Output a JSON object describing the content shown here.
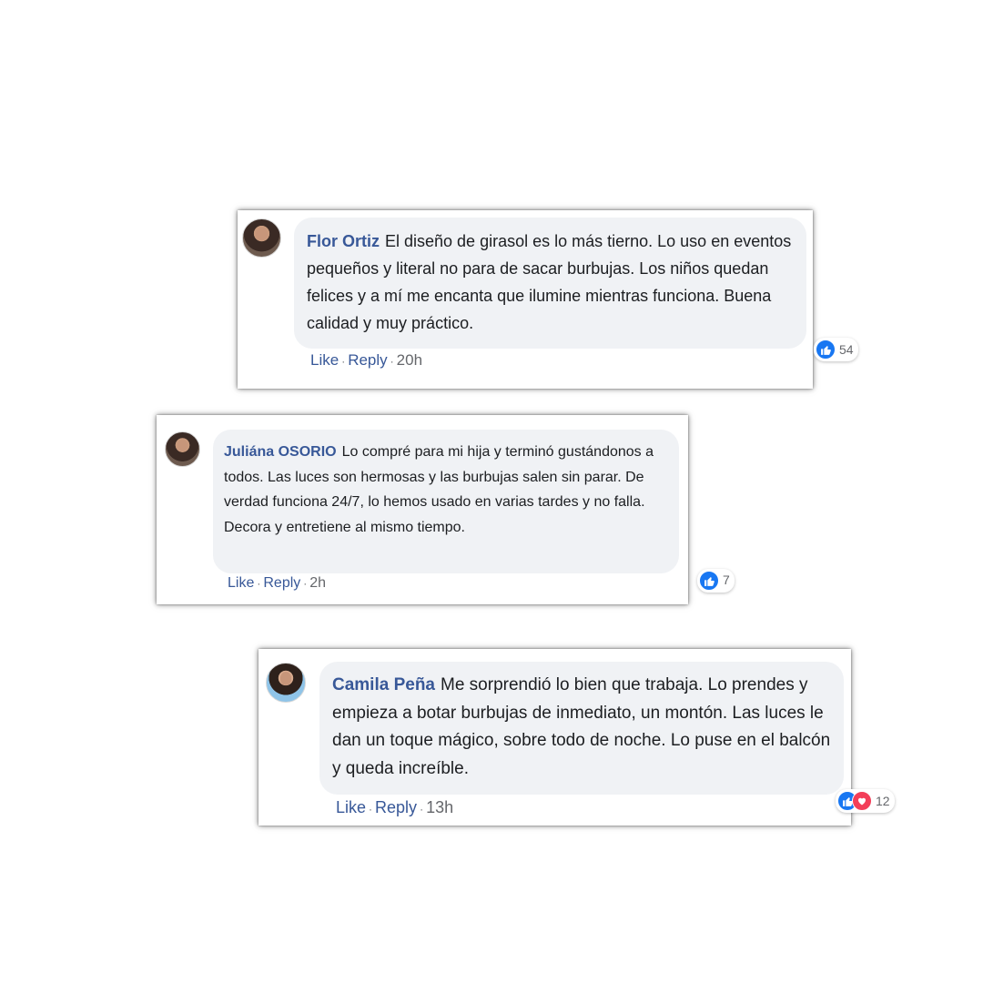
{
  "comments": [
    {
      "author": "Flor Ortiz",
      "text": "El diseño de girasol es lo más tierno. Lo uso en eventos pequeños y literal no para de sacar burbujas. Los niños quedan felices y a mí me encanta que ilumine mientras funciona. Buena calidad y muy práctico.",
      "reactions": [
        "like"
      ],
      "reaction_count": "54",
      "like_label": "Like",
      "reply_label": "Reply",
      "time": "20h"
    },
    {
      "author": "Juliána OSORIO",
      "text": "Lo compré para mi hija y terminó gustándonos a todos. Las luces son hermosas y las burbujas salen sin parar. De verdad funciona 24/7, lo hemos usado en varias tardes y no falla. Decora y entretiene al mismo tiempo.",
      "reactions": [
        "like"
      ],
      "reaction_count": "7",
      "like_label": "Like",
      "reply_label": "Reply",
      "time": "2h"
    },
    {
      "author": "Camila Peña",
      "text": "Me sorprendió lo bien que trabaja. Lo prendes y empieza a botar burbujas de inmediato, un montón. Las luces le dan un toque mágico, sobre todo de noche. Lo puse en el balcón y queda increíble.",
      "reactions": [
        "like",
        "love"
      ],
      "reaction_count": "12",
      "like_label": "Like",
      "reply_label": "Reply",
      "time": "13h"
    }
  ],
  "separator": "·",
  "colors": {
    "author": "#385898",
    "bubble": "#f0f2f5",
    "like": "#1877f2",
    "love": "#f33e58",
    "meta": "#65676b"
  }
}
